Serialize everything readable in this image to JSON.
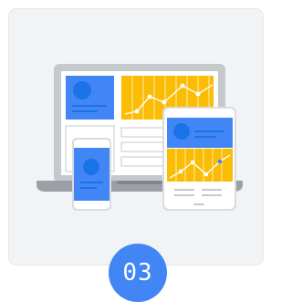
{
  "step": {
    "number": "03"
  },
  "illustration": {
    "icon": "responsive-devices-icon",
    "devices": [
      "laptop",
      "phone",
      "tablet"
    ]
  },
  "colors": {
    "card_background": "#f1f3f4",
    "blue": "#4285f4",
    "dark_blue": "#1a73e8",
    "yellow": "#fbbc04",
    "device_gray": "#c6c9cc",
    "badge": "#4285f4"
  }
}
